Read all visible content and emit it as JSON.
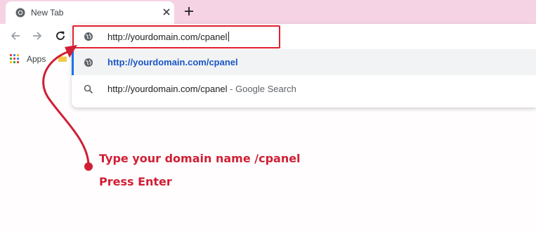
{
  "tab": {
    "title": "New Tab",
    "favicon": "chrome-icon"
  },
  "toolbar": {
    "back": "arrow-left-icon",
    "forward": "arrow-right-icon",
    "reload": "reload-icon"
  },
  "omnibox": {
    "value": "http://yourdomain.com/cpanel",
    "suggestions": [
      {
        "text": "http://yourdomain.com/cpanel",
        "suffix": "",
        "icon": "globe-icon"
      },
      {
        "text": "http://yourdomain.com/cpanel",
        "suffix": " - Google Search",
        "icon": "search-icon"
      }
    ]
  },
  "bookmarks": {
    "apps_label": "Apps"
  },
  "annotation": {
    "line1": "Type your domain name /cpanel",
    "line2": "Press Enter"
  },
  "colors": {
    "annotation": "#d01f35",
    "tabstrip": "#f6d3e4",
    "link": "#1a56c4",
    "selection": "#1a73e8"
  }
}
